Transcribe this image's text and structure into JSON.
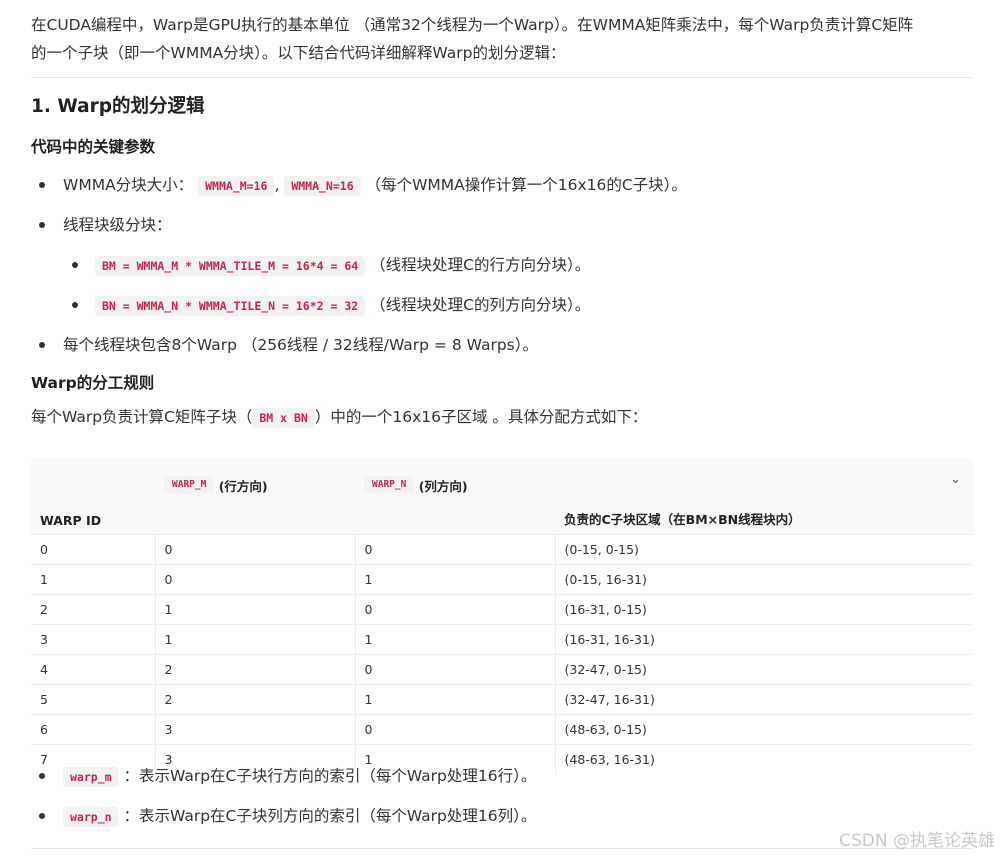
{
  "intro": {
    "line1": "在CUDA编程中，Warp是GPU执行的基本单位 （通常32个线程为一个Warp）。在WMMA矩阵乘法中，每个Warp负责计算C矩阵",
    "line2": "的一个子块（即一个WMMA分块）。以下结合代码详细解释Warp的划分逻辑："
  },
  "section1": {
    "title": "1. Warp的划分逻辑",
    "params_title": "代码中的关键参数",
    "item1": {
      "label": "WMMA分块大小：",
      "code1": "WMMA_M=16",
      "sep": ",",
      "code2": "WMMA_N=16",
      "desc": "（每个WMMA操作计算一个16x16的C子块）。"
    },
    "item2": {
      "label": "线程块级分块："
    },
    "sub1": {
      "code": "BM = WMMA_M * WMMA_TILE_M = 16*4 = 64",
      "desc": "（线程块处理C的行方向分块）。"
    },
    "sub2": {
      "code": "BN = WMMA_N * WMMA_TILE_N = 16*2 = 32",
      "desc": "（线程块处理C的列方向分块）。"
    },
    "item3": {
      "text": "每个线程块包含8个Warp （256线程 / 32线程/Warp = 8 Warps）。"
    },
    "rules_title": "Warp的分工规则",
    "rules_pre": "每个Warp负责计算C矩阵子块（",
    "rules_code": "BM x BN",
    "rules_post": "）中的一个16x16子区域 。具体分配方式如下："
  },
  "table": {
    "headers": {
      "warp_id": "WARP ID",
      "warp_m_code": "WARP_M",
      "warp_m_suffix": "(行方向)",
      "warp_n_code": "WARP_N",
      "warp_n_suffix": "(列方向)",
      "region": "负责的C子块区域（在BM×BN线程块内）"
    },
    "chevron_icon": "chevron-down-icon",
    "rows": [
      [
        "0",
        "0",
        "0",
        "(0-15, 0-15)"
      ],
      [
        "1",
        "0",
        "1",
        "(0-15, 16-31)"
      ],
      [
        "2",
        "1",
        "0",
        "(16-31, 0-15)"
      ],
      [
        "3",
        "1",
        "1",
        "(16-31, 16-31)"
      ],
      [
        "4",
        "2",
        "0",
        "(32-47, 0-15)"
      ],
      [
        "5",
        "2",
        "1",
        "(32-47, 16-31)"
      ],
      [
        "6",
        "3",
        "0",
        "(48-63, 0-15)"
      ],
      [
        "7",
        "3",
        "1",
        "(48-63, 16-31)"
      ]
    ]
  },
  "notes": {
    "n1": {
      "code": "warp_m",
      "desc": "：表示Warp在C子块行方向的索引（每个Warp处理16行）。"
    },
    "n2": {
      "code": "warp_n",
      "desc": "：表示Warp在C子块列方向的索引（每个Warp处理16列）。"
    }
  },
  "watermark": "CSDN @执笔论英雄",
  "colors": {
    "code_text": "#c7254e",
    "code_bg": "#f2f2f2"
  }
}
